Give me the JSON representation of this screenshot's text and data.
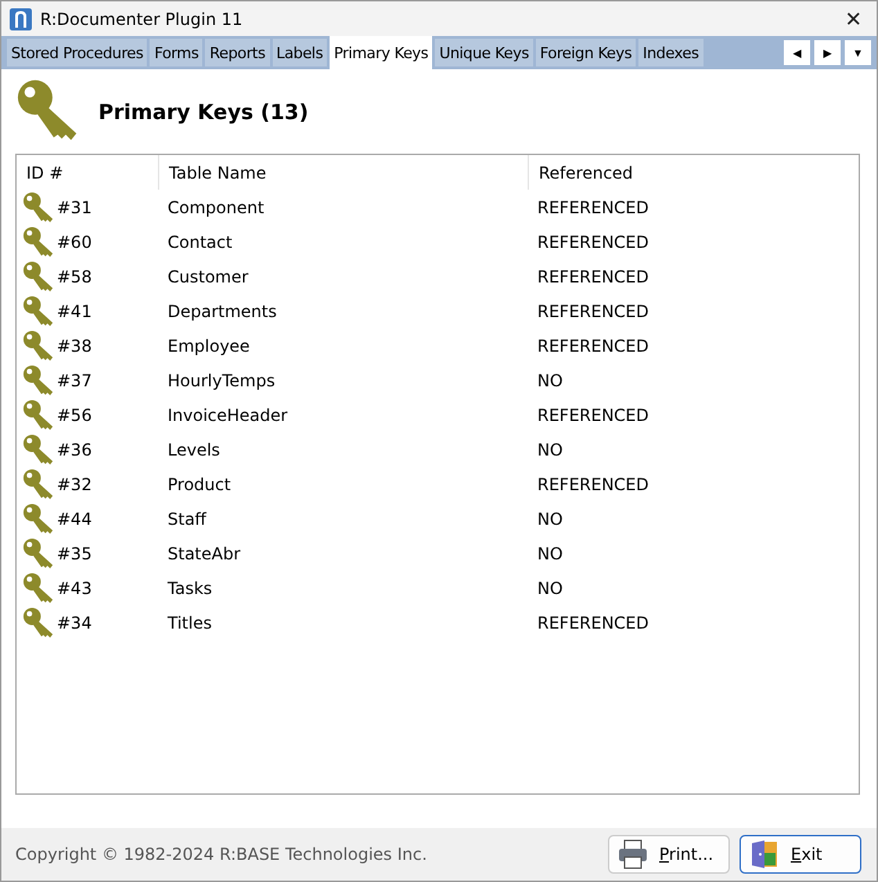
{
  "window": {
    "title": "R:Documenter Plugin 11",
    "close": "✕"
  },
  "tabs": [
    {
      "label": "Stored Procedures",
      "selected": false
    },
    {
      "label": "Forms",
      "selected": false
    },
    {
      "label": "Reports",
      "selected": false
    },
    {
      "label": "Labels",
      "selected": false
    },
    {
      "label": "Primary Keys",
      "selected": true
    },
    {
      "label": "Unique Keys",
      "selected": false
    },
    {
      "label": "Foreign Keys",
      "selected": false
    },
    {
      "label": "Indexes",
      "selected": false
    }
  ],
  "tab_nav": [
    "◀",
    "▶",
    "▼"
  ],
  "heading": "Primary Keys (13)",
  "table": {
    "columns": [
      "ID #",
      "Table Name",
      "Referenced"
    ],
    "rows": [
      [
        "#31",
        "Component",
        "REFERENCED"
      ],
      [
        "#60",
        "Contact",
        "REFERENCED"
      ],
      [
        "#58",
        "Customer",
        "REFERENCED"
      ],
      [
        "#41",
        "Departments",
        "REFERENCED"
      ],
      [
        "#38",
        "Employee",
        "REFERENCED"
      ],
      [
        "#37",
        "HourlyTemps",
        "NO"
      ],
      [
        "#56",
        "InvoiceHeader",
        "REFERENCED"
      ],
      [
        "#36",
        "Levels",
        "NO"
      ],
      [
        "#32",
        "Product",
        "REFERENCED"
      ],
      [
        "#44",
        "Staff",
        "NO"
      ],
      [
        "#35",
        "StateAbr",
        "NO"
      ],
      [
        "#43",
        "Tasks",
        "NO"
      ],
      [
        "#34",
        "Titles",
        "REFERENCED"
      ]
    ]
  },
  "status_bar": {
    "copyright": "Copyright © 1982-2024 R:BASE Technologies Inc.",
    "buttons": [
      {
        "label": "Print...",
        "kind": "print",
        "selected": false
      },
      {
        "label": "Exit",
        "kind": "exit",
        "selected": true
      }
    ]
  }
}
